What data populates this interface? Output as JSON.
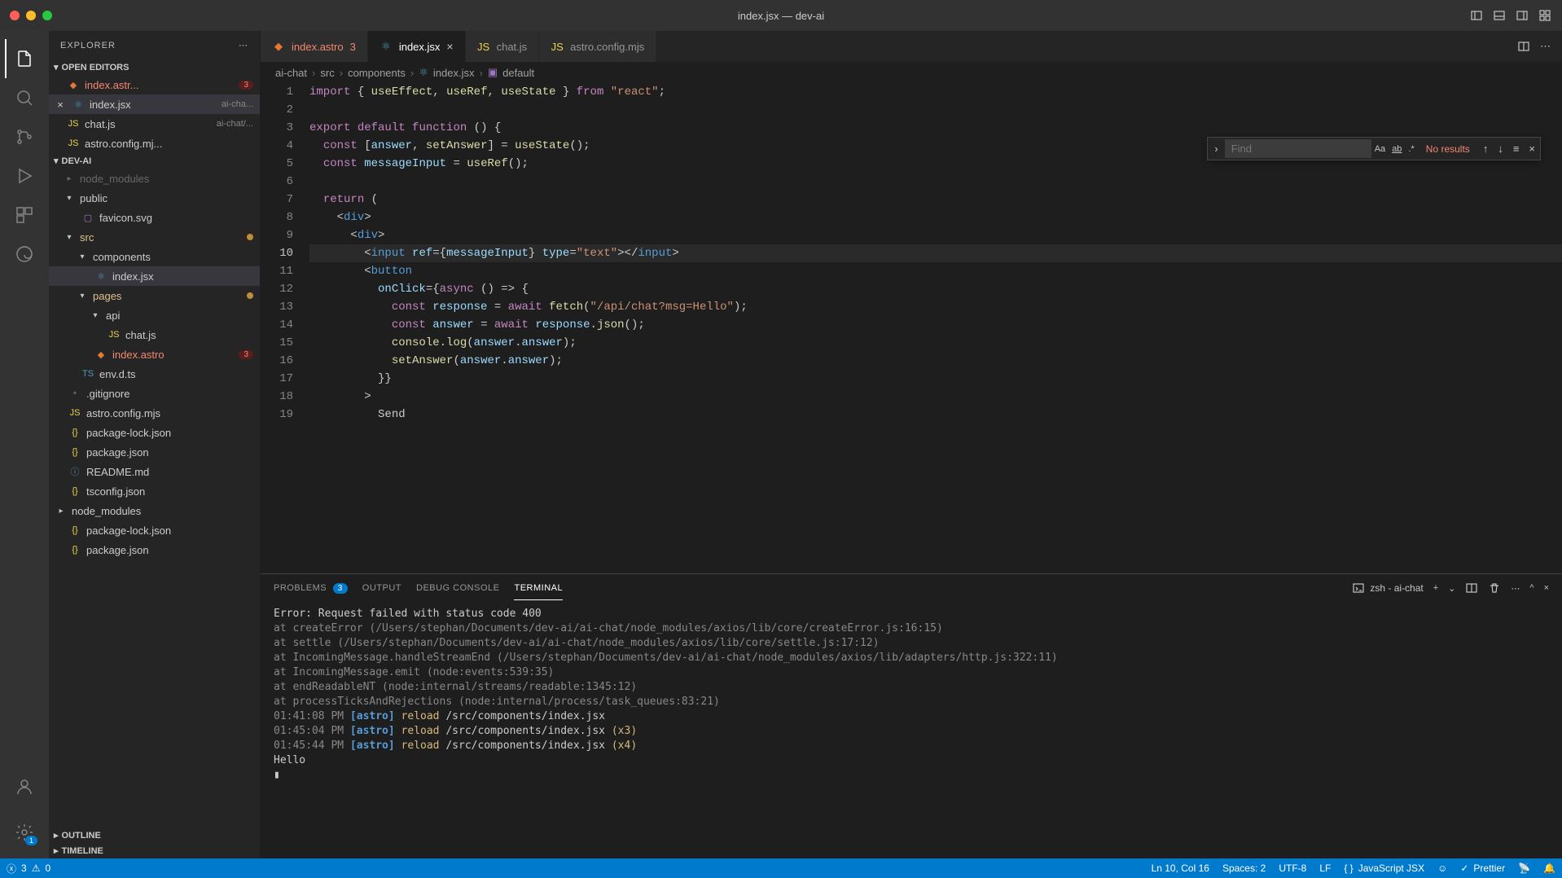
{
  "window": {
    "title": "index.jsx — dev-ai"
  },
  "sidebar": {
    "title": "EXPLORER",
    "sections": {
      "open_editors": "OPEN EDITORS",
      "project": "DEV-AI",
      "outline": "OUTLINE",
      "timeline": "TIMELINE"
    },
    "open_editors": [
      {
        "name": "index.astr...",
        "badge": "3"
      },
      {
        "name": "index.jsx",
        "tail": "ai-cha..."
      },
      {
        "name": "chat.js",
        "tail": "ai-chat/..."
      },
      {
        "name": "astro.config.mj..."
      }
    ],
    "tree": {
      "node_modules_top": "node_modules",
      "public": "public",
      "favicon": "favicon.svg",
      "src": "src",
      "components": "components",
      "index_jsx": "index.jsx",
      "pages": "pages",
      "api": "api",
      "chat_js": "chat.js",
      "index_astro": "index.astro",
      "index_astro_badge": "3",
      "env": "env.d.ts",
      "gitignore": ".gitignore",
      "astro_config": "astro.config.mjs",
      "pkg_lock": "package-lock.json",
      "pkg": "package.json",
      "readme": "README.md",
      "tsconfig": "tsconfig.json",
      "node_modules": "node_modules",
      "pkg_lock2": "package-lock.json",
      "pkg2": "package.json"
    }
  },
  "tabs": [
    {
      "name": "index.astro",
      "badge": "3"
    },
    {
      "name": "index.jsx"
    },
    {
      "name": "chat.js"
    },
    {
      "name": "astro.config.mjs"
    }
  ],
  "breadcrumbs": [
    "ai-chat",
    "src",
    "components",
    "index.jsx",
    "default"
  ],
  "find": {
    "placeholder": "Find",
    "results": "No results"
  },
  "code": {
    "lines": [
      "import { useEffect, useRef, useState } from \"react\";",
      "",
      "export default function () {",
      "  const [answer, setAnswer] = useState();",
      "  const messageInput = useRef();",
      "",
      "  return (",
      "    <div>",
      "      <div>",
      "        <input ref={messageInput} type=\"text\"></input>",
      "        <button",
      "          onClick={async () => {",
      "            const response = await fetch(\"/api/chat?msg=Hello\");",
      "            const answer = await response.json();",
      "            console.log(answer.answer);",
      "            setAnswer(answer.answer);",
      "          }}",
      "        >",
      "          Send"
    ],
    "first_line_no": 1,
    "active_line": 10
  },
  "panel": {
    "tabs": {
      "problems": "PROBLEMS",
      "problems_count": "3",
      "output": "OUTPUT",
      "debug": "DEBUG CONSOLE",
      "terminal": "TERMINAL"
    },
    "shell": "zsh - ai-chat",
    "terminal_lines": [
      {
        "type": "err",
        "text": "Error: Request failed with status code 400"
      },
      {
        "type": "stack",
        "text": "    at createError (/Users/stephan/Documents/dev-ai/ai-chat/node_modules/axios/lib/core/createError.js:16:15)"
      },
      {
        "type": "stack",
        "text": "    at settle (/Users/stephan/Documents/dev-ai/ai-chat/node_modules/axios/lib/core/settle.js:17:12)"
      },
      {
        "type": "stack",
        "text": "    at IncomingMessage.handleStreamEnd (/Users/stephan/Documents/dev-ai/ai-chat/node_modules/axios/lib/adapters/http.js:322:11)"
      },
      {
        "type": "stack",
        "text": "    at IncomingMessage.emit (node:events:539:35)"
      },
      {
        "type": "stack",
        "text": "    at endReadableNT (node:internal/streams/readable:1345:12)"
      },
      {
        "type": "stack",
        "text": "    at processTicksAndRejections (node:internal/process/task_queues:83:21)"
      },
      {
        "type": "reload",
        "ts": "01:41:08 PM",
        "tag": "[astro]",
        "act": "reload",
        "path": "/src/components/index.jsx",
        "suffix": ""
      },
      {
        "type": "reload",
        "ts": "01:45:04 PM",
        "tag": "[astro]",
        "act": "reload",
        "path": "/src/components/index.jsx",
        "suffix": " (x3)"
      },
      {
        "type": "reload",
        "ts": "01:45:44 PM",
        "tag": "[astro]",
        "act": "reload",
        "path": "/src/components/index.jsx",
        "suffix": " (x4)"
      },
      {
        "type": "plain",
        "text": "Hello"
      },
      {
        "type": "cursor",
        "text": "▮"
      }
    ]
  },
  "status": {
    "remote_badge": "1",
    "errors": "3",
    "warnings": "0",
    "cursor": "Ln 10, Col 16",
    "spaces": "Spaces: 2",
    "encoding": "UTF-8",
    "eol": "LF",
    "lang": "JavaScript JSX",
    "prettier": "Prettier"
  }
}
